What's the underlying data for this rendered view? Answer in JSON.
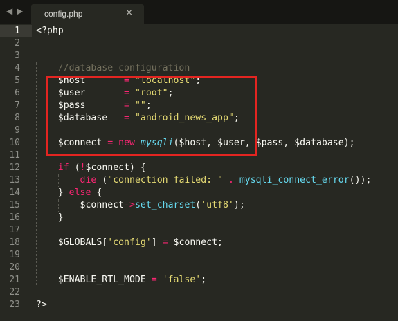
{
  "tab_bar": {
    "nav_left_glyph": "◀",
    "nav_right_glyph": "▶",
    "tab_label": "config.php",
    "close_glyph": "×"
  },
  "editor": {
    "theme_colors": {
      "background": "#272822",
      "keyword": "#f92672",
      "string": "#e6db74",
      "function": "#66d9ef",
      "comment": "#75715e",
      "text": "#f8f8f2",
      "highlight_border": "#e32521"
    },
    "active_line": 1,
    "line_numbers": [
      "1",
      "2",
      "3",
      "4",
      "5",
      "6",
      "7",
      "8",
      "9",
      "10",
      "11",
      "12",
      "13",
      "14",
      "15",
      "16",
      "17",
      "18",
      "19",
      "20",
      "21",
      "22",
      "23"
    ],
    "lines": [
      [
        {
          "t": "<?php",
          "c": "pl"
        }
      ],
      [],
      [],
      [
        {
          "t": "    //database configuration",
          "c": "cmt"
        }
      ],
      [
        {
          "t": "    $host       ",
          "c": "pl"
        },
        {
          "t": "=",
          "c": "kw"
        },
        {
          "t": " ",
          "c": "pl"
        },
        {
          "t": "\"localhost\"",
          "c": "str"
        },
        {
          "t": ";",
          "c": "pl"
        }
      ],
      [
        {
          "t": "    $user       ",
          "c": "pl"
        },
        {
          "t": "=",
          "c": "kw"
        },
        {
          "t": " ",
          "c": "pl"
        },
        {
          "t": "\"root\"",
          "c": "str"
        },
        {
          "t": ";",
          "c": "pl"
        }
      ],
      [
        {
          "t": "    $pass       ",
          "c": "pl"
        },
        {
          "t": "=",
          "c": "kw"
        },
        {
          "t": " ",
          "c": "pl"
        },
        {
          "t": "\"\"",
          "c": "str"
        },
        {
          "t": ";",
          "c": "pl"
        }
      ],
      [
        {
          "t": "    $database   ",
          "c": "pl"
        },
        {
          "t": "=",
          "c": "kw"
        },
        {
          "t": " ",
          "c": "pl"
        },
        {
          "t": "\"android_news_app\"",
          "c": "str"
        },
        {
          "t": ";",
          "c": "pl"
        }
      ],
      [],
      [
        {
          "t": "    $connect ",
          "c": "pl"
        },
        {
          "t": "=",
          "c": "kw"
        },
        {
          "t": " ",
          "c": "pl"
        },
        {
          "t": "new",
          "c": "kw"
        },
        {
          "t": " ",
          "c": "pl"
        },
        {
          "t": "mysqli",
          "c": "cls"
        },
        {
          "t": "($host, $user, $pass, $database);",
          "c": "pl"
        }
      ],
      [],
      [
        {
          "t": "    ",
          "c": "pl"
        },
        {
          "t": "if",
          "c": "kw"
        },
        {
          "t": " (",
          "c": "pl"
        },
        {
          "t": "!",
          "c": "kw"
        },
        {
          "t": "$connect) {",
          "c": "pl"
        }
      ],
      [
        {
          "t": "        ",
          "c": "pl"
        },
        {
          "t": "die",
          "c": "kw"
        },
        {
          "t": " (",
          "c": "pl"
        },
        {
          "t": "\"connection failed: \"",
          "c": "str"
        },
        {
          "t": " ",
          "c": "pl"
        },
        {
          "t": ".",
          "c": "kw"
        },
        {
          "t": " ",
          "c": "pl"
        },
        {
          "t": "mysqli_connect_error",
          "c": "fn"
        },
        {
          "t": "());",
          "c": "pl"
        }
      ],
      [
        {
          "t": "    } ",
          "c": "pl"
        },
        {
          "t": "else",
          "c": "kw"
        },
        {
          "t": " {",
          "c": "pl"
        }
      ],
      [
        {
          "t": "        $connect",
          "c": "pl"
        },
        {
          "t": "->",
          "c": "kw"
        },
        {
          "t": "set_charset",
          "c": "fn"
        },
        {
          "t": "(",
          "c": "pl"
        },
        {
          "t": "'utf8'",
          "c": "str"
        },
        {
          "t": ");",
          "c": "pl"
        }
      ],
      [
        {
          "t": "    }",
          "c": "pl"
        }
      ],
      [],
      [
        {
          "t": "    $GLOBALS[",
          "c": "pl"
        },
        {
          "t": "'config'",
          "c": "str"
        },
        {
          "t": "] ",
          "c": "pl"
        },
        {
          "t": "=",
          "c": "kw"
        },
        {
          "t": " $connect;",
          "c": "pl"
        }
      ],
      [],
      [],
      [
        {
          "t": "    $ENABLE_RTL_MODE ",
          "c": "pl"
        },
        {
          "t": "=",
          "c": "kw"
        },
        {
          "t": " ",
          "c": "pl"
        },
        {
          "t": "'false'",
          "c": "str"
        },
        {
          "t": ";",
          "c": "pl"
        }
      ],
      [],
      [
        {
          "t": "?>",
          "c": "pl"
        }
      ]
    ]
  }
}
